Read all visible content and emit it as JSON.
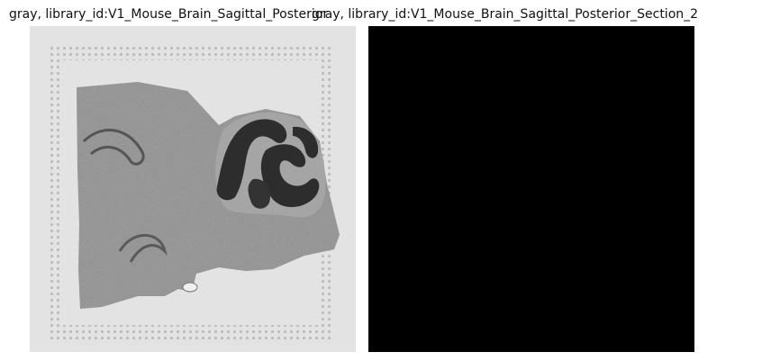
{
  "panels": [
    {
      "title": "gray, library_id:V1_Mouse_Brain_Sagittal_Posterior",
      "content": "grayscale H&E tissue section image"
    },
    {
      "title": "gray, library_id:V1_Mouse_Brain_Sagittal_Posterior_Section_2",
      "content": "black image"
    }
  ],
  "colors": {
    "left_background": "#e3e3e3",
    "right_background": "#000000",
    "tissue": "#8f8f8f",
    "cerebellum_dark": "#2a2a2a"
  }
}
